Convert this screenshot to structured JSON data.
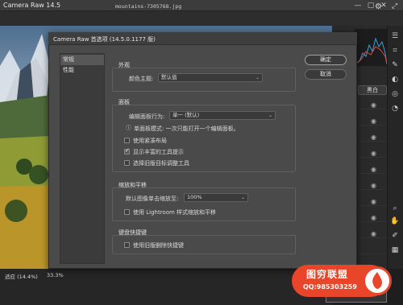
{
  "app": {
    "title": "Camera Raw 14.5",
    "filename": "mountains-7305768.jpg"
  },
  "window_controls": {
    "minimize": "—",
    "maximize": "▢",
    "close": "✕"
  },
  "status": {
    "zoom": "适应 (14.4%)",
    "zoom_value": "33.3%"
  },
  "right_panel": {
    "bw_label": "黑白"
  },
  "dialog": {
    "title": "Camera Raw 首选项 (14.5.0.1177 版)",
    "nav": [
      {
        "label": "常规",
        "active": true
      },
      {
        "label": "性能",
        "active": false
      }
    ],
    "buttons": {
      "ok": "确定",
      "cancel": "取消"
    },
    "appearance": {
      "heading": "外观",
      "theme_label": "颜色主题:",
      "theme_value": "默认值"
    },
    "panels": {
      "heading": "面板",
      "behavior_label": "编辑面板行为:",
      "behavior_value": "单一 (默认)",
      "info_text": "单面板模式: 一次只能打开一个编辑面板。",
      "checkboxes": [
        {
          "label": "使用紧凑布局",
          "checked": false
        },
        {
          "label": "显示丰富的工具提示",
          "checked": true
        },
        {
          "label": "选择旧版目标调整工具",
          "checked": false
        }
      ]
    },
    "zoom_pan": {
      "heading": "缩放和平移",
      "default_zoom_label": "默认图像单击缩放至:",
      "default_zoom_value": "100%",
      "lightroom_label": "使用 Lightroom 样式缩放和平移",
      "lightroom_checked": false
    },
    "keyboard": {
      "heading": "键盘快捷键",
      "legacy_label": "使用旧版删除快捷键",
      "legacy_checked": false
    }
  },
  "watermark": {
    "line1": "图穷联盟",
    "line2": "QQ:985303259"
  }
}
